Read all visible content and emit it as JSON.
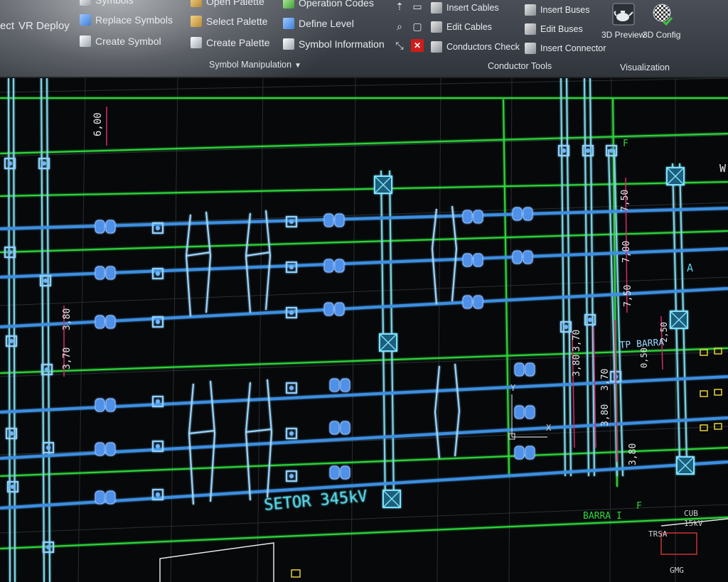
{
  "ribbon": {
    "left_cut": "ect",
    "vr_deploy": "VR Deploy",
    "symbols_cut": "Symbols",
    "replace_symbols": "Replace Symbols",
    "create_symbol": "Create Symbol",
    "open_palette": "Open Palette",
    "select_palette": "Select Palette",
    "create_palette": "Create Palette",
    "operation_codes": "Operation Codes",
    "define_level": "Define Level",
    "symbol_information": "Symbol Information",
    "group_symbol": "Symbol Manipulation",
    "insert_cables": "Insert Cables",
    "edit_cables": "Edit Cables",
    "conductors_check": "Conductors Check",
    "insert_buses": "Insert Buses",
    "edit_buses": "Edit Buses",
    "insert_connector": "Insert Connector",
    "group_conductor": "Conductor Tools",
    "preview_3d": "3D Preview",
    "config_3d": "3D Config",
    "group_visual": "Visualization"
  },
  "drawing": {
    "dim_top": "6,00",
    "dim_750a": "7,50",
    "dim_700": "7,00",
    "dim_750b": "7,50",
    "dim_380": "3,80",
    "dim_370": "3,70",
    "dim_380b": "3,80",
    "dim_370b": "3,70",
    "dim_380c": "3,80",
    "dim_370c": "3,70",
    "dim_380d": "3,80",
    "dim_050": "0,50",
    "dim_250": "2,50",
    "tp_barra": "TP BARRA",
    "setor": "SETOR 345kV",
    "barra_i": "BARRA I",
    "label_f_top": "F",
    "label_f_bot": "F",
    "label_a": "A",
    "label_w": "W",
    "trsa": "TRSA",
    "cub": "CUB",
    "cub_kv": "15kV",
    "gmg": "GMG",
    "ucs_y": "Y",
    "ucs_x": "X"
  }
}
